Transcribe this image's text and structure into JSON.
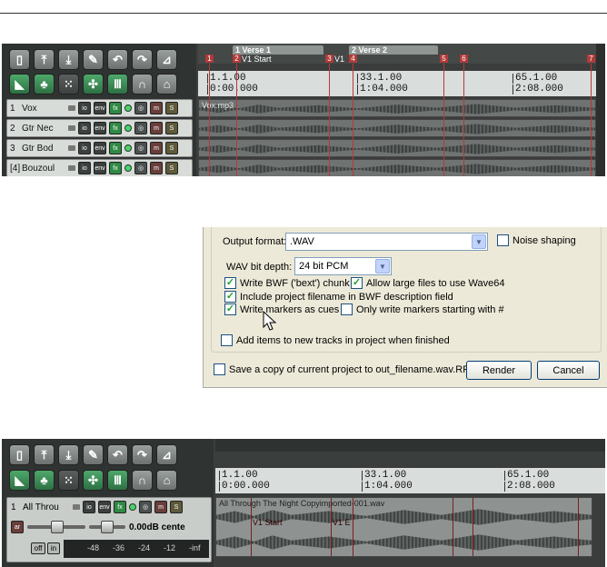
{
  "top_panel": {
    "regions": [
      {
        "label": "1 Verse 1",
        "sub": "V1 Start"
      },
      {
        "label": "2 Verse 2",
        "sub": "V1"
      }
    ],
    "markers": [
      "1",
      "2",
      "3",
      "4",
      "5",
      "6",
      "7"
    ],
    "ruler": [
      {
        "bar": "1.1.00",
        "time": "0:00.000"
      },
      {
        "bar": "33.1.00",
        "time": "1:04.000"
      },
      {
        "bar": "65.1.00",
        "time": "2:08.000"
      }
    ],
    "tracks": [
      {
        "num": "1",
        "name": "Vox",
        "item": "Vox.mp3"
      },
      {
        "num": "2",
        "name": "Gtr Nec",
        "item": ""
      },
      {
        "num": "3",
        "name": "Gtr Bod",
        "item": ""
      },
      {
        "num": "[4]",
        "name": "Bouzoul",
        "item": ""
      }
    ],
    "track_buttons": {
      "io": "io",
      "env": "env",
      "fx": "fx",
      "m": "m",
      "s": "S"
    }
  },
  "dialog": {
    "output_format_label": "Output format:",
    "output_format_value": ".WAV",
    "noise_shaping": "Noise shaping",
    "noise_shaping_checked": false,
    "bit_depth_label": "WAV bit depth:",
    "bit_depth_value": "24 bit PCM",
    "write_bwf": "Write BWF ('bext') chunk",
    "write_bwf_checked": true,
    "allow_large": "Allow large files to use Wave64",
    "allow_large_checked": true,
    "include_filename": "Include project filename in BWF description field",
    "include_filename_checked": true,
    "write_markers": "Write markers as cues",
    "write_markers_checked": true,
    "only_write_markers": "Only write markers starting with #",
    "only_write_markers_checked": false,
    "add_items": "Add items to new tracks in project when finished",
    "add_items_checked": false,
    "save_copy": "Save a copy of current project to out_filename.wav.RPP",
    "save_copy_checked": false,
    "render_button": "Render",
    "cancel_button": "Cancel"
  },
  "bottom_panel": {
    "ruler": [
      {
        "bar": "1.1.00",
        "time": "0:00.000"
      },
      {
        "bar": "33.1.00",
        "time": "1:04.000"
      },
      {
        "bar": "65.1.00",
        "time": "2:08.000"
      }
    ],
    "track": {
      "num": "1",
      "name": "All Throu",
      "volume": "0.00dB cente",
      "item": "All Through The Night Copyimported-001.wav",
      "cue_labels": [
        "V1 Start",
        "V1 E"
      ],
      "meter_ticks": [
        "-48",
        "-36",
        "-24",
        "-12",
        "-inf"
      ],
      "auto_button": "ar",
      "off_button": "off",
      "in_button": "in"
    }
  }
}
